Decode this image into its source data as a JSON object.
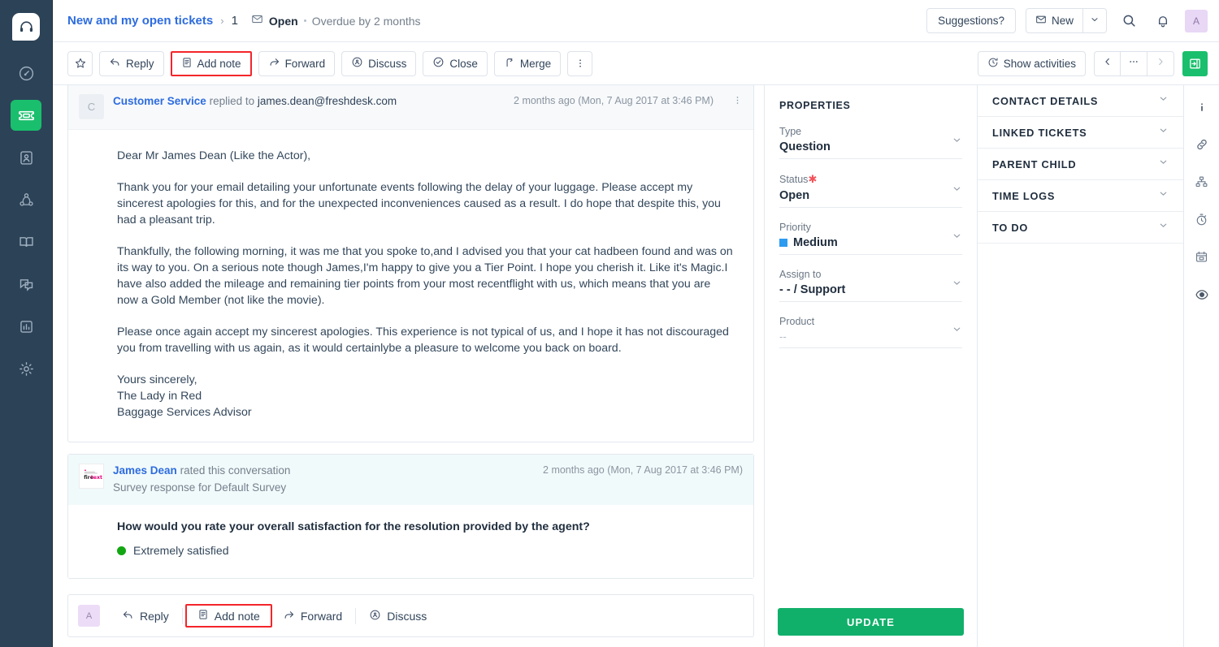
{
  "left_nav": {
    "logo_icon": "headset-logo-icon",
    "items": [
      {
        "icon": "dashboard-gauge-icon",
        "name": "dashboard",
        "active": false
      },
      {
        "icon": "ticket-icon",
        "name": "tickets",
        "active": true
      },
      {
        "icon": "contacts-person-icon",
        "name": "contacts",
        "active": false
      },
      {
        "icon": "customers-network-icon",
        "name": "customers",
        "active": false
      },
      {
        "icon": "solutions-book-icon",
        "name": "solutions",
        "active": false
      },
      {
        "icon": "forums-chat-icon",
        "name": "forums",
        "active": false
      },
      {
        "icon": "reports-bar-chart-icon",
        "name": "reports",
        "active": false
      },
      {
        "icon": "admin-gear-icon",
        "name": "admin",
        "active": false
      }
    ]
  },
  "header": {
    "breadcrumb_link": "New and my open tickets",
    "breadcrumb_separator": "›",
    "ticket_id": "1",
    "status_icon": "envelope-icon",
    "status": "Open",
    "overdue": "Overdue by 2 months",
    "suggestions_label": "Suggestions?",
    "new_label": "New",
    "new_icon": "envelope-icon",
    "new_caret_icon": "chevron-down-icon",
    "search_icon": "search-icon",
    "bell_icon": "notification-bell-icon",
    "avatar_initial": "A"
  },
  "toolbar": {
    "star_icon": "star-outline-icon",
    "buttons": [
      {
        "label": "Reply",
        "icon": "reply-arrow-icon",
        "highlighted": false
      },
      {
        "label": "Add note",
        "icon": "note-document-icon",
        "highlighted": true
      },
      {
        "label": "Forward",
        "icon": "forward-arrow-icon",
        "highlighted": false
      },
      {
        "label": "Discuss",
        "icon": "discuss-circle-icon",
        "highlighted": false
      },
      {
        "label": "Close",
        "icon": "check-circle-icon",
        "highlighted": false
      },
      {
        "label": "Merge",
        "icon": "merge-icon",
        "highlighted": false
      }
    ],
    "more_icon": "kebab-vertical-icon",
    "show_activities_label": "Show activities",
    "show_activities_icon": "history-clock-icon",
    "prev_icon": "chevron-left-icon",
    "pager_more_icon": "ellipsis-icon",
    "next_icon": "chevron-right-icon",
    "collapse_icon": "collapse-panel-icon",
    "accent_color": "#19bf6c",
    "highlight_color": "#f4252a"
  },
  "conversation": {
    "reply_card": {
      "avatar_initial": "C",
      "author": "Customer Service",
      "action": "replied to",
      "recipient": "james.dean@freshdesk.com",
      "timestamp": "2 months ago (Mon, 7 Aug 2017 at 3:46 PM)",
      "kebab_icon": "kebab-vertical-icon",
      "paragraphs": [
        "Dear Mr James Dean (Like the Actor),",
        "Thank you for your email detailing your unfortunate events following the delay of your luggage. Please accept my sincerest apologies for this, and for the unexpected inconveniences caused as a result. I do hope that despite this, you had a pleasant trip.",
        "Thankfully, the following morning, it was me that you spoke to,and I advised you that your cat hadbeen found and was on its way to you. On a serious note though James,I'm happy to give you a Tier Point. I hope you cherish it. Like it's Magic.I have also added the mileage and remaining tier points from your most recentflight with us, which means that you are now a Gold Member (not like the movie).",
        "Please once again accept my sincerest apologies. This experience is not typical of us, and I hope it has not discouraged you from travelling with us again, as it would certainlybe a pleasure to welcome you back on board."
      ],
      "signature": [
        "Yours sincerely,",
        "The Lady in Red",
        "Baggage Services Advisor"
      ]
    },
    "survey_card": {
      "logo_text": "firetext",
      "author": "James Dean",
      "action": "rated this conversation",
      "subtitle": "Survey response for Default Survey",
      "timestamp": "2 months ago (Mon, 7 Aug 2017 at 3:46 PM)",
      "question": "How would you rate your overall satisfaction for the resolution provided by the agent?",
      "answer": "Extremely satisfied",
      "answer_color": "#12a712"
    }
  },
  "reply_bar": {
    "avatar_initial": "A",
    "items": [
      {
        "label": "Reply",
        "icon": "reply-arrow-icon",
        "highlighted": false
      },
      {
        "label": "Add note",
        "icon": "note-document-icon",
        "highlighted": true
      },
      {
        "label": "Forward",
        "icon": "forward-arrow-icon",
        "highlighted": false
      },
      {
        "label": "Discuss",
        "icon": "discuss-circle-icon",
        "highlighted": false
      }
    ]
  },
  "properties": {
    "title": "PROPERTIES",
    "fields": [
      {
        "label": "Type",
        "value": "Question",
        "required": false,
        "swatch": null,
        "muted": false
      },
      {
        "label": "Status",
        "value": "Open",
        "required": true,
        "swatch": null,
        "muted": false
      },
      {
        "label": "Priority",
        "value": "Medium",
        "required": false,
        "swatch": "#2d9bf0",
        "muted": false
      },
      {
        "label": "Assign to",
        "value": "- - / Support",
        "required": false,
        "swatch": null,
        "muted": false
      },
      {
        "label": "Product",
        "value": "--",
        "required": false,
        "swatch": null,
        "muted": true
      }
    ],
    "update_label": "UPDATE",
    "update_color": "#11b06a"
  },
  "right_panel": {
    "sections": [
      {
        "label": "CONTACT DETAILS"
      },
      {
        "label": "LINKED TICKETS"
      },
      {
        "label": "PARENT CHILD"
      },
      {
        "label": "TIME LOGS"
      },
      {
        "label": "TO DO"
      }
    ],
    "rail_icons": [
      {
        "icon": "info-icon",
        "name": "info"
      },
      {
        "icon": "link-chain-icon",
        "name": "linked-tickets"
      },
      {
        "icon": "hierarchy-icon",
        "name": "parent-child"
      },
      {
        "icon": "stopwatch-icon",
        "name": "time-logs"
      },
      {
        "icon": "calendar-todo-icon",
        "name": "to-do"
      },
      {
        "icon": "eye-scanner-icon",
        "name": "activity"
      }
    ]
  }
}
